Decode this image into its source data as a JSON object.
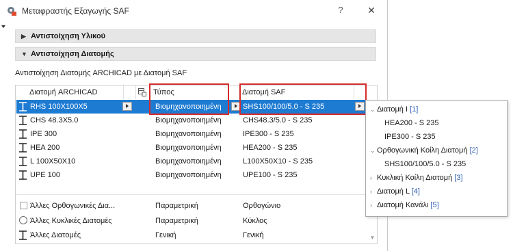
{
  "window": {
    "title": "Μεταφραστής Εξαγωγής SAF",
    "help_label": "?",
    "close_label": "✕"
  },
  "sections": {
    "material": {
      "label": "Αντιστοίχηση Υλικού",
      "expanded": false
    },
    "profile": {
      "label": "Αντιστοίχηση Διατομής",
      "expanded": true
    }
  },
  "subtitle": "Αντιστοίχηση Διατομής ARCHICAD με Διατομή SAF",
  "table": {
    "headers": {
      "archicad": "Διατομή ARCHICAD",
      "type": "Τύπος",
      "saf": "Διατομή SAF"
    },
    "rows": [
      {
        "archicad": "RHS 100X100X5",
        "type": "Βιομηχανοποιημένη",
        "saf": "SHS100/100/5.0 - S 235"
      },
      {
        "archicad": "CHS 48.3X5.0",
        "type": "Βιομηχανοποιημένη",
        "saf": "CHS48.3/5.0 - S 235"
      },
      {
        "archicad": "IPE 300",
        "type": "Βιομηχανοποιημένη",
        "saf": "IPE300 - S 235"
      },
      {
        "archicad": "HEA 200",
        "type": "Βιομηχανοποιημένη",
        "saf": "HEA200 - S 235"
      },
      {
        "archicad": "L 100X50X10",
        "type": "Βιομηχανοποιημένη",
        "saf": "L100X50X10 - S 235"
      },
      {
        "archicad": "UPE 100",
        "type": "Βιομηχανοποιημένη",
        "saf": "UPE100 - S 235"
      }
    ],
    "other_rows": [
      {
        "archicad": "Άλλες Ορθογωνικές Δια...",
        "type": "Παραμετρική",
        "saf": "Ορθογώνιο"
      },
      {
        "archicad": "Άλλες Κυκλικές Διατομές",
        "type": "Παραμετρική",
        "saf": "Κύκλος"
      },
      {
        "archicad": "Άλλες Διατομές",
        "type": "Γενική",
        "saf": "Γενική"
      }
    ]
  },
  "popup": {
    "groups": [
      {
        "label": "Διατομή I",
        "count": "[1]",
        "expanded": true,
        "items": [
          "HEA200 - S 235",
          "IPE300 - S 235"
        ]
      },
      {
        "label": "Ορθογωνική Κοίλη Διατομή",
        "count": "[2]",
        "expanded": true,
        "items": [
          "SHS100/100/5.0 - S 235"
        ]
      },
      {
        "label": "Κυκλική  Κοίλη Διατομή",
        "count": "[3]",
        "expanded": false,
        "items": []
      },
      {
        "label": "Διατομή L",
        "count": "[4]",
        "expanded": false,
        "items": []
      },
      {
        "label": "Διατομή Κανάλι",
        "count": "[5]",
        "expanded": false,
        "items": []
      }
    ]
  },
  "colors": {
    "selection": "#1e7bd2",
    "highlight_box": "#d62b2b",
    "count_text": "#2f5fb3"
  },
  "icons": {
    "app": "gear-export-icon",
    "profile_row": "i-beam-profile-icon",
    "column_settings": "table-settings-icon"
  }
}
